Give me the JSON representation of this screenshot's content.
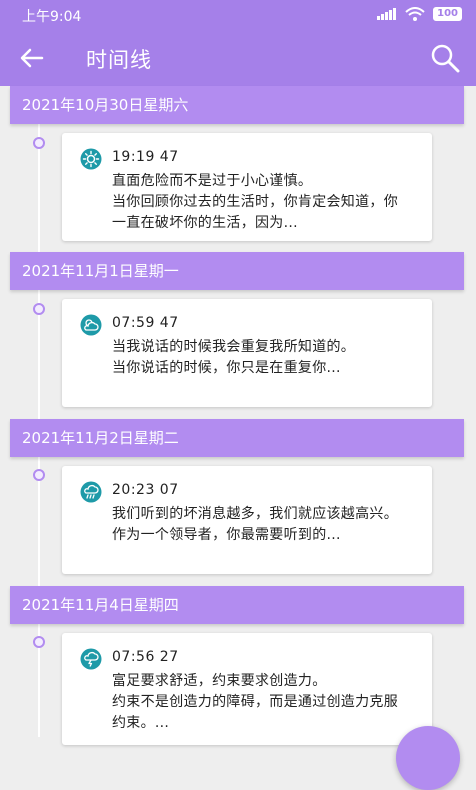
{
  "status_bar": {
    "time": "上午9:04",
    "battery": "100"
  },
  "app_bar": {
    "title": "时间线"
  },
  "colors": {
    "accent": "#a580e9",
    "header": "#b28cf0",
    "icon_teal": "#1e9aa8"
  },
  "entries": [
    {
      "date": "2021年10月30日星期六",
      "time": "19:19 47",
      "icon": "sunny-icon",
      "text": "直面危险而不是过于小心谨慎。\n当你回顾你过去的生活时，你肯定会知道，你一直在破坏你的生活，因为..."
    },
    {
      "date": "2021年11月1日星期一",
      "time": "07:59 47",
      "icon": "partly-cloudy-icon",
      "text": "当我说话的时候我会重复我所知道的。\n当你说话的时候，你只是在重复你..."
    },
    {
      "date": "2021年11月2日星期二",
      "time": "20:23 07",
      "icon": "rain-icon",
      "text": "我们听到的坏消息越多，我们就应该越高兴。\n作为一个领导者，你最需要听到的..."
    },
    {
      "date": "2021年11月4日星期四",
      "time": "07:56 27",
      "icon": "thunderstorm-icon",
      "text": "富足要求舒适，约束要求创造力。\n约束不是创造力的障碍，而是通过创造力克服约束。..."
    }
  ]
}
